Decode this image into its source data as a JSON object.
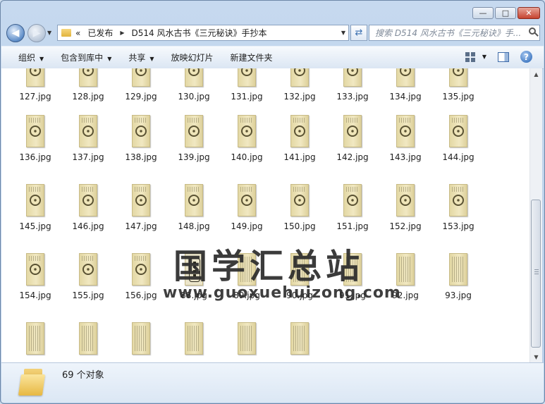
{
  "window": {
    "caption": {
      "minimize": "—",
      "maximize": "□",
      "close": "✕"
    }
  },
  "nav": {
    "back_glyph": "◀",
    "forward_glyph": "▶",
    "breadcrumb_prefix": "«",
    "breadcrumbs": [
      "已发布",
      "D514 风水古书《三元秘诀》手抄本"
    ],
    "search_placeholder": "搜索 D514 风水古书《三元秘诀》手..."
  },
  "toolbar": {
    "organize": "组织",
    "include_in_library": "包含到库中",
    "share": "共享",
    "slideshow": "放映幻灯片",
    "new_folder": "新建文件夹",
    "help": "?"
  },
  "files": {
    "row1": [
      "127.jpg",
      "128.jpg",
      "129.jpg",
      "130.jpg",
      "131.jpg",
      "132.jpg",
      "133.jpg",
      "134.jpg",
      "135.jpg"
    ],
    "row2": [
      "136.jpg",
      "137.jpg",
      "138.jpg",
      "139.jpg",
      "140.jpg",
      "141.jpg",
      "142.jpg",
      "143.jpg",
      "144.jpg"
    ],
    "row3": [
      "145.jpg",
      "146.jpg",
      "147.jpg",
      "148.jpg",
      "149.jpg",
      "150.jpg",
      "151.jpg",
      "152.jpg",
      "153.jpg"
    ],
    "row4": [
      "154.jpg",
      "155.jpg",
      "156.jpg",
      "88.jpg",
      "89.jpg",
      "90.jpg",
      "91.jpg",
      "92.jpg",
      "93.jpg"
    ],
    "row5_count": 6
  },
  "watermark": {
    "title": "国学汇总站",
    "url": "www.guoxuehuizong.com"
  },
  "details": {
    "count": "69 个对象"
  }
}
